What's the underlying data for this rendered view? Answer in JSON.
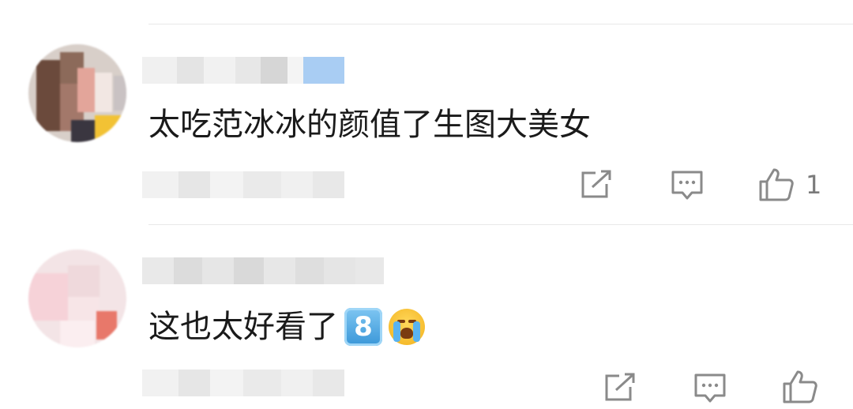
{
  "comments": [
    {
      "text": "太吃范冰冰的颜值了生图大美女",
      "like_count": "1",
      "icons": {
        "share": "share-icon",
        "reply": "reply-icon",
        "like": "thumbs-up-icon"
      }
    },
    {
      "text": "这也太好看了",
      "emoji_keycap": "8",
      "emoji_cry": "loudly-crying-face-icon",
      "like_count": "",
      "icons": {
        "share": "share-icon",
        "reply": "reply-icon",
        "like": "thumbs-up-icon"
      }
    }
  ],
  "colors": {
    "text": "#1a1a1a",
    "icon": "#8a8a8a",
    "divider": "#e9e9e9",
    "vip_badge": "#a9cdf3"
  }
}
